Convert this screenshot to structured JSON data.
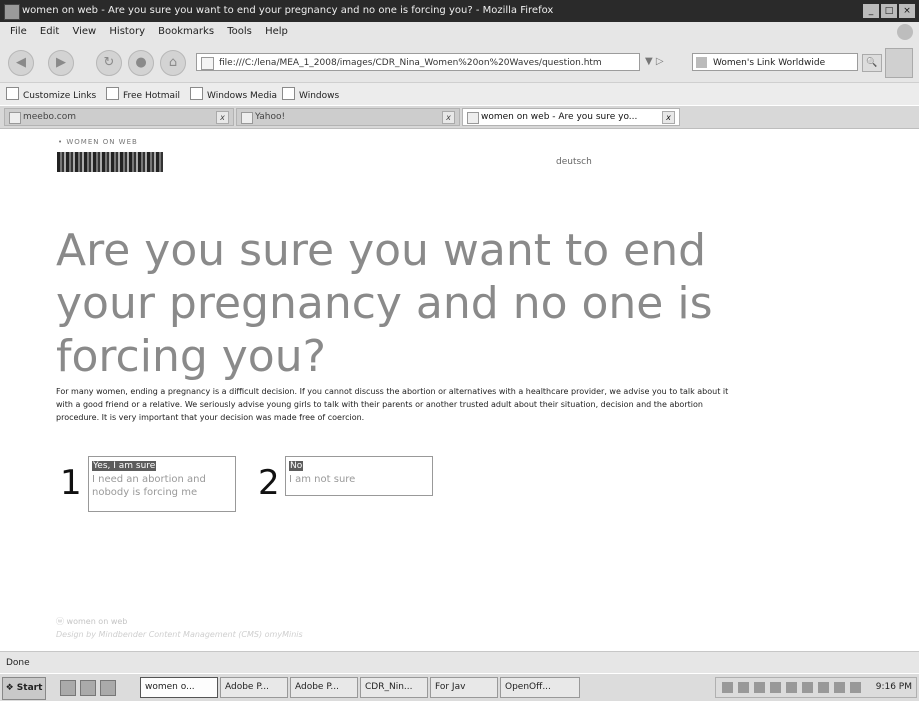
{
  "window": {
    "title": "women on web - Are you sure you want to end your pregnancy and no one is forcing you? - Mozilla Firefox",
    "controls": [
      "_",
      "□",
      "×"
    ]
  },
  "menu": [
    "File",
    "Edit",
    "View",
    "History",
    "Bookmarks",
    "Tools",
    "Help"
  ],
  "nav": {
    "back": "◀",
    "forward": "▶",
    "reload": "↻",
    "stop": "●",
    "home": "⌂",
    "url": "file:///C:/lena/MEA_1_2008/images/CDR_Nina_Women%20on%20Waves/question.htm",
    "search_engine": "Women's Link Worldwide",
    "search_go": "🔍"
  },
  "bookmarks": [
    "Customize Links",
    "Free Hotmail",
    "Windows Media",
    "Windows"
  ],
  "tabs": [
    {
      "label": "meebo.com",
      "active": false
    },
    {
      "label": "Yahoo!",
      "active": false
    },
    {
      "label": "women on web - Are you sure yo...",
      "active": true
    }
  ],
  "page": {
    "brand_small": "• WOMEN ON WEB",
    "lang_link": "deutsch",
    "headline": "Are you sure you want to end your pregnancy and no one is forcing you?",
    "intro": "For many women, ending a pregnancy is a difficult decision. If you cannot discuss the abortion or alternatives with a healthcare provider, we advise you to talk about it with a good friend or a relative. We seriously advise young girls to talk with their parents or another trusted adult about their situation, decision and the abortion procedure. It is very important that your decision was made free of coercion.",
    "choices": [
      {
        "number": "1",
        "title": "Yes, I am sure",
        "text": "I need an abortion and nobody is forcing me"
      },
      {
        "number": "2",
        "title": "No",
        "text": "I am not sure"
      }
    ],
    "footer_logo": "ⓦ women on web",
    "footer_credit": "Design by Mindbender Content Management (CMS) omyMinis"
  },
  "status": "Done",
  "taskbar": {
    "start": "Start",
    "tasks": [
      {
        "label": "women o...",
        "active": true
      },
      {
        "label": "Adobe P...",
        "active": false
      },
      {
        "label": "Adobe P...",
        "active": false
      },
      {
        "label": "CDR_Nin...",
        "active": false
      },
      {
        "label": "For Jav",
        "active": false
      },
      {
        "label": "OpenOff...",
        "active": false
      }
    ],
    "clock": "9:16 PM"
  }
}
